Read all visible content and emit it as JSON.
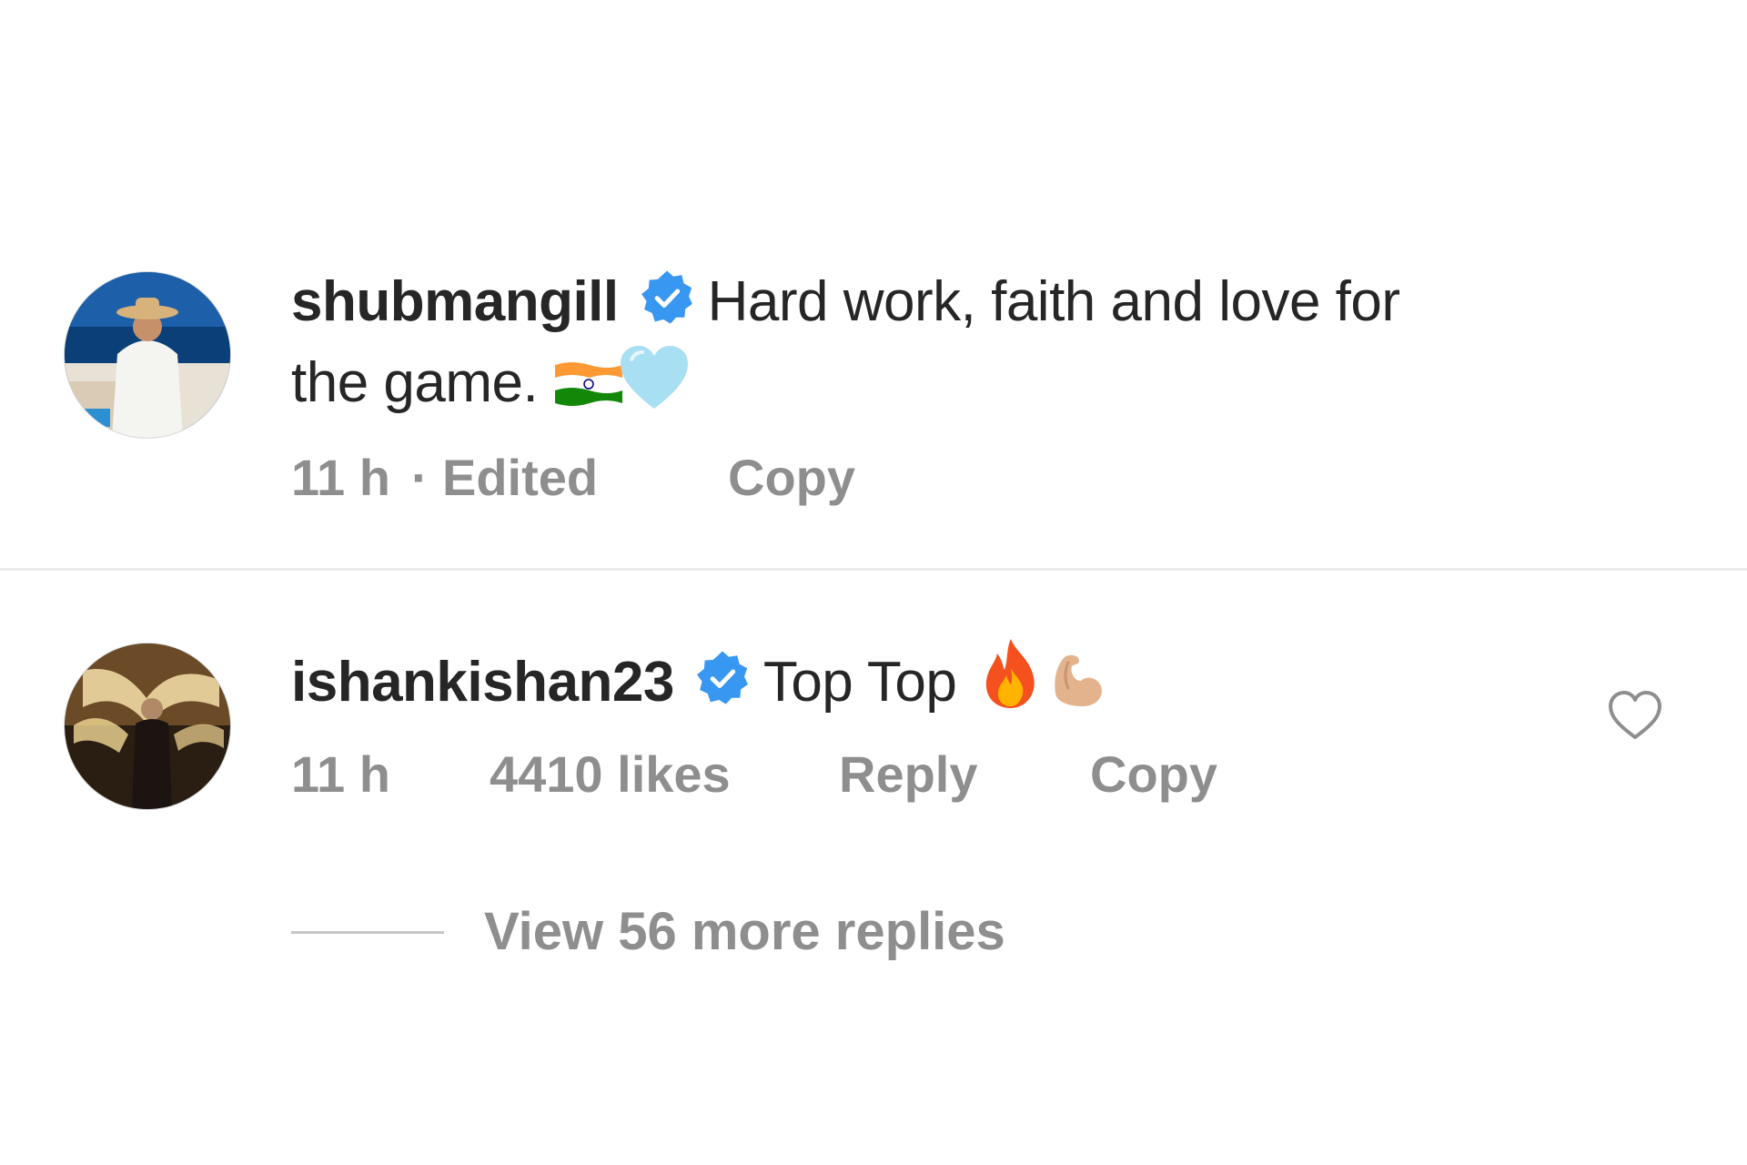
{
  "comments": [
    {
      "username": "shubmangill",
      "verified": true,
      "text_line1": "Hard work, faith and love for",
      "text_line2": "the game.",
      "emojis": [
        "india-flag-emoji",
        "light-blue-heart-emoji"
      ],
      "time": "11 h",
      "separator": "·",
      "edited": "Edited",
      "copy_label": "Copy"
    },
    {
      "username": "ishankishan23",
      "verified": true,
      "text": "Top Top",
      "emojis": [
        "fire-emoji",
        "flexed-biceps-emoji"
      ],
      "time": "11 h",
      "likes": "4410 likes",
      "reply_label": "Reply",
      "copy_label": "Copy",
      "like_icon": "heart-outline-icon"
    }
  ],
  "view_replies": {
    "label": "View 56 more replies"
  },
  "colors": {
    "text_primary": "#262626",
    "text_secondary": "#8e8e8e",
    "verified_blue": "#3897f0",
    "divider": "#ececec"
  }
}
